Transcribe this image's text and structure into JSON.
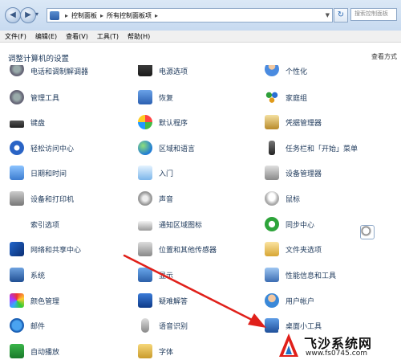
{
  "address_bar": {
    "path": [
      "控制面板",
      "所有控制面板项"
    ],
    "search_placeholder": "搜索控制面板"
  },
  "menu": [
    "文件(F)",
    "编辑(E)",
    "查看(V)",
    "工具(T)",
    "帮助(H)"
  ],
  "header": {
    "title": "调整计算机的设置",
    "view_by": "查看方式"
  },
  "items": {
    "col1": [
      "电话和调制解调器",
      "管理工具",
      "键盘",
      "轻松访问中心",
      "日期和时间",
      "设备和打印机",
      "索引选项",
      "网络和共享中心",
      "系统",
      "颜色管理",
      "邮件",
      "自动播放"
    ],
    "col2": [
      "电源选项",
      "恢复",
      "默认程序",
      "区域和语言",
      "入门",
      "声音",
      "通知区域图标",
      "位置和其他传感器",
      "显示",
      "疑难解答",
      "语音识别",
      "字体"
    ],
    "col3": [
      "个性化",
      "家庭组",
      "凭据管理器",
      "任务栏和「开始」菜单",
      "设备管理器",
      "鼠标",
      "同步中心",
      "文件夹选项",
      "性能信息和工具",
      "用户帐户",
      "桌面小工具"
    ]
  },
  "watermark": {
    "brand": "飞沙系统网",
    "url": "www.fs0745.com"
  },
  "colors": {
    "arrow": "#e0201a",
    "link_text": "#1e395b"
  }
}
